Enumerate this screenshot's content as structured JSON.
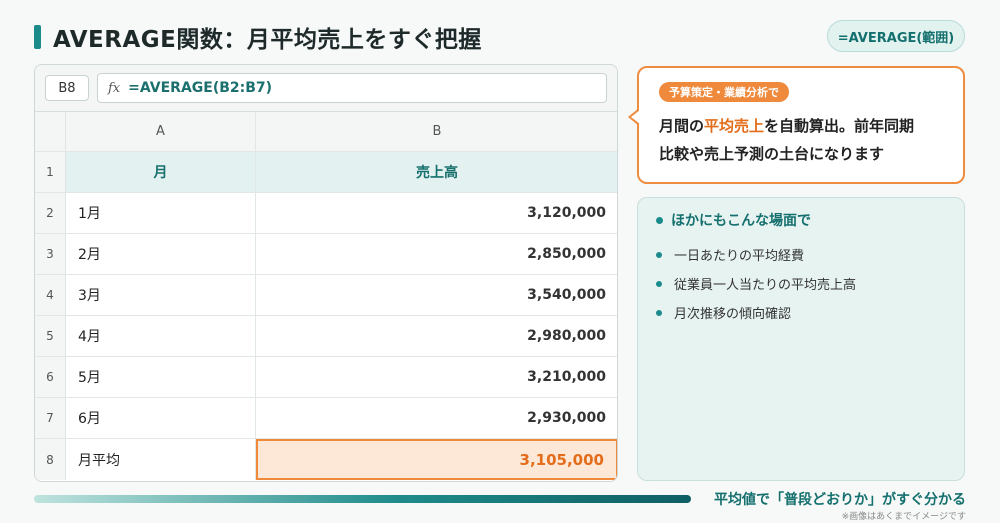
{
  "title": "AVERAGE関数：月平均売上をすぐ把握",
  "formula_pill": "=AVERAGE(範囲)",
  "sheet": {
    "cell_ref": "B8",
    "fx_label": "fx",
    "formula": "=AVERAGE(B2:B7)",
    "col_headers": [
      "A",
      "B"
    ],
    "rows": [
      {
        "n": "1",
        "a": "月",
        "b": "売上高"
      },
      {
        "n": "2",
        "a": "1月",
        "b": "3,120,000"
      },
      {
        "n": "3",
        "a": "2月",
        "b": "2,850,000"
      },
      {
        "n": "4",
        "a": "3月",
        "b": "3,540,000"
      },
      {
        "n": "5",
        "a": "4月",
        "b": "2,980,000"
      },
      {
        "n": "6",
        "a": "5月",
        "b": "3,210,000"
      },
      {
        "n": "7",
        "a": "6月",
        "b": "2,930,000"
      },
      {
        "n": "8",
        "a": "月平均",
        "b": "3,105,000"
      }
    ]
  },
  "callout": {
    "badge": "予算策定・業績分析で",
    "line1_pre": "月間の",
    "line1_hl": "平均売上",
    "line1_post": "を自動算出。前年同期",
    "line2": "比較や売上予測の土台になります"
  },
  "cases": {
    "title": "ほかにもこんな場面で",
    "items": [
      "一日あたりの平均経費",
      "従業員一人当たりの平均売上高",
      "月次推移の傾向確認"
    ]
  },
  "footer": {
    "tagline": "平均値で「普段どおりか」がすぐ分かる",
    "note": "※画像はあくまでイメージです"
  },
  "colors": {
    "accent": "#1a8a8a",
    "highlight": "#ef8a3c",
    "highlight_fill": "#fde8d8"
  }
}
